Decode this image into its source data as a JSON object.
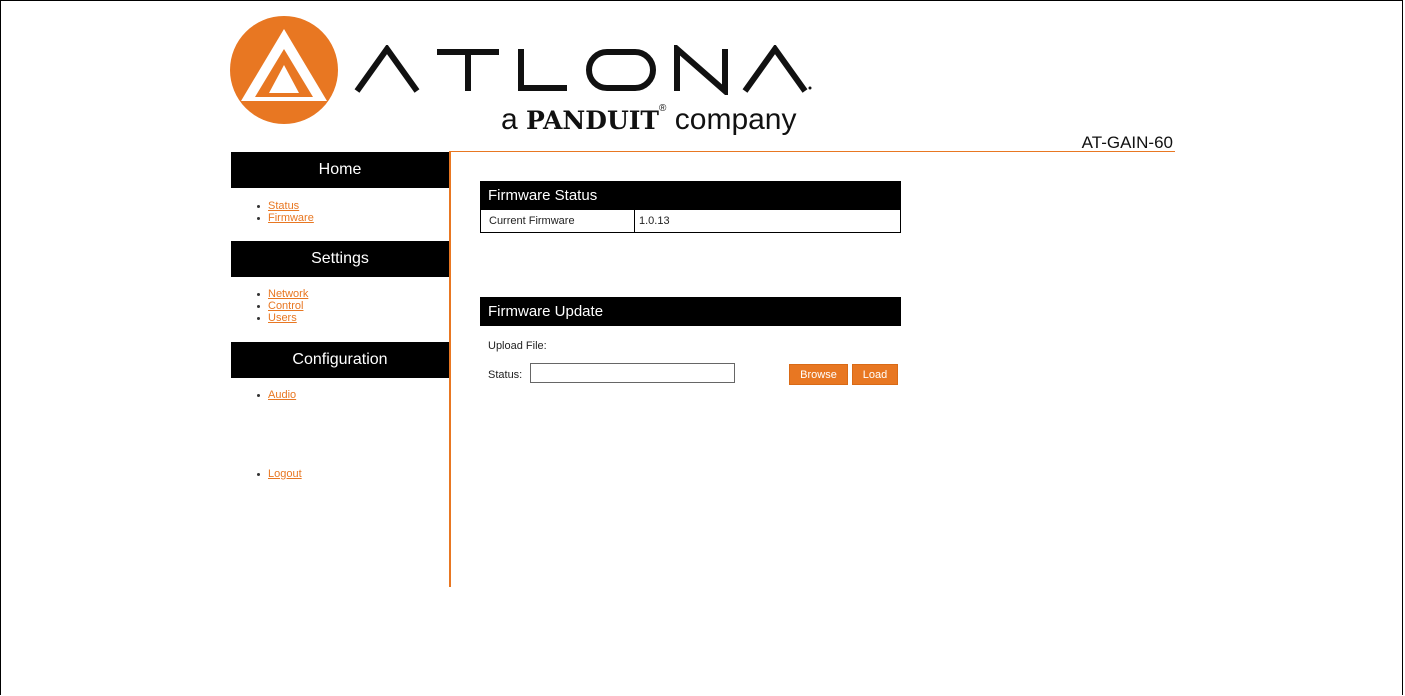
{
  "brand": {
    "logo_text": "ATLONA",
    "tagline_prefix": "a",
    "tagline_brand": "PANDUIT",
    "tagline_reg": "®",
    "tagline_suffix": "company",
    "model": "AT-GAIN-60",
    "accent_color": "#e87722"
  },
  "sidebar": {
    "sections": [
      {
        "title": "Home",
        "items": [
          {
            "label": "Status"
          },
          {
            "label": "Firmware"
          }
        ]
      },
      {
        "title": "Settings",
        "items": [
          {
            "label": "Network"
          },
          {
            "label": "Control"
          },
          {
            "label": "Users"
          }
        ]
      },
      {
        "title": "Configuration",
        "items": [
          {
            "label": "Audio"
          }
        ]
      }
    ],
    "logout": "Logout"
  },
  "firmware_status": {
    "title": "Firmware Status",
    "label": "Current Firmware",
    "value": "1.0.13"
  },
  "firmware_update": {
    "title": "Firmware Update",
    "upload_label": "Upload File:",
    "status_label": "Status:",
    "status_value": "",
    "browse_label": "Browse",
    "load_label": "Load"
  }
}
